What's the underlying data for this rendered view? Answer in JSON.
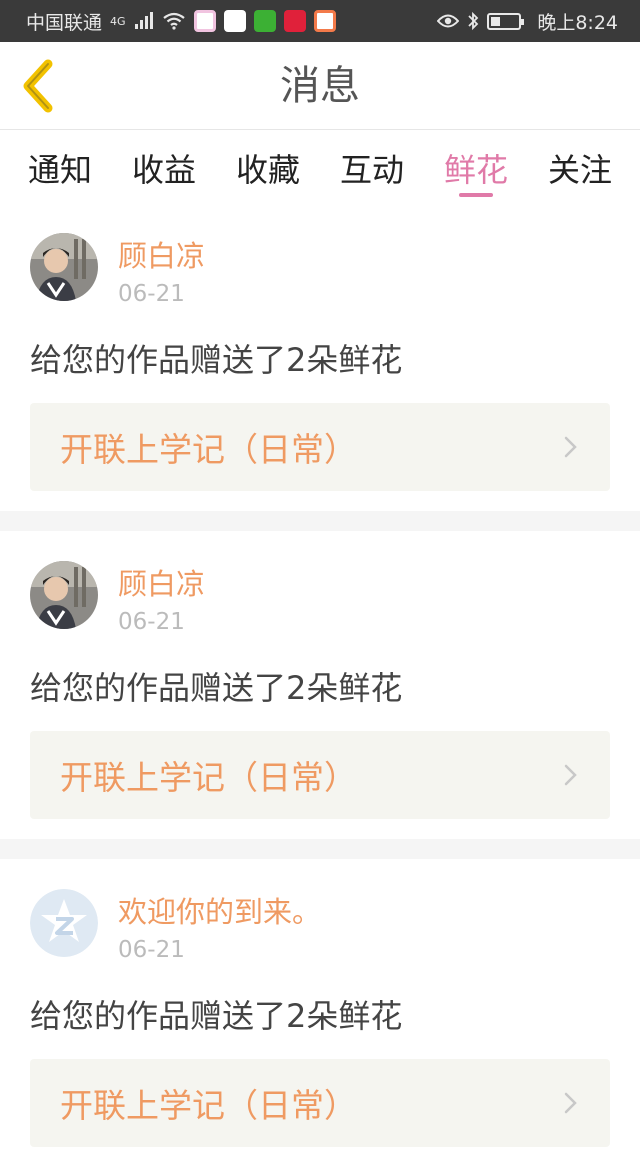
{
  "status_bar": {
    "carrier": "中国联通",
    "network": "4G",
    "time": "晚上8:24"
  },
  "header": {
    "title": "消息",
    "back_icon": "chevron-left-icon"
  },
  "tabs": [
    {
      "label": "通知",
      "active": false
    },
    {
      "label": "收益",
      "active": false
    },
    {
      "label": "收藏",
      "active": false
    },
    {
      "label": "互动",
      "active": false
    },
    {
      "label": "鲜花",
      "active": true
    },
    {
      "label": "关注",
      "active": false
    }
  ],
  "messages": [
    {
      "user": "顾白凉",
      "date": "06-21",
      "text": "给您的作品赠送了2朵鲜花",
      "work": "开联上学记（日常）",
      "avatar": "photo-avatar"
    },
    {
      "user": "顾白凉",
      "date": "06-21",
      "text": "给您的作品赠送了2朵鲜花",
      "work": "开联上学记（日常）",
      "avatar": "photo-avatar"
    },
    {
      "user": "欢迎你的到来。",
      "date": "06-21",
      "text": "给您的作品赠送了2朵鲜花",
      "work": "开联上学记（日常）",
      "avatar": "default-avatar"
    }
  ],
  "colors": {
    "accent_pink": "#e07aa8",
    "accent_orange": "#ef9a62",
    "back_arrow": "#f2c200"
  }
}
